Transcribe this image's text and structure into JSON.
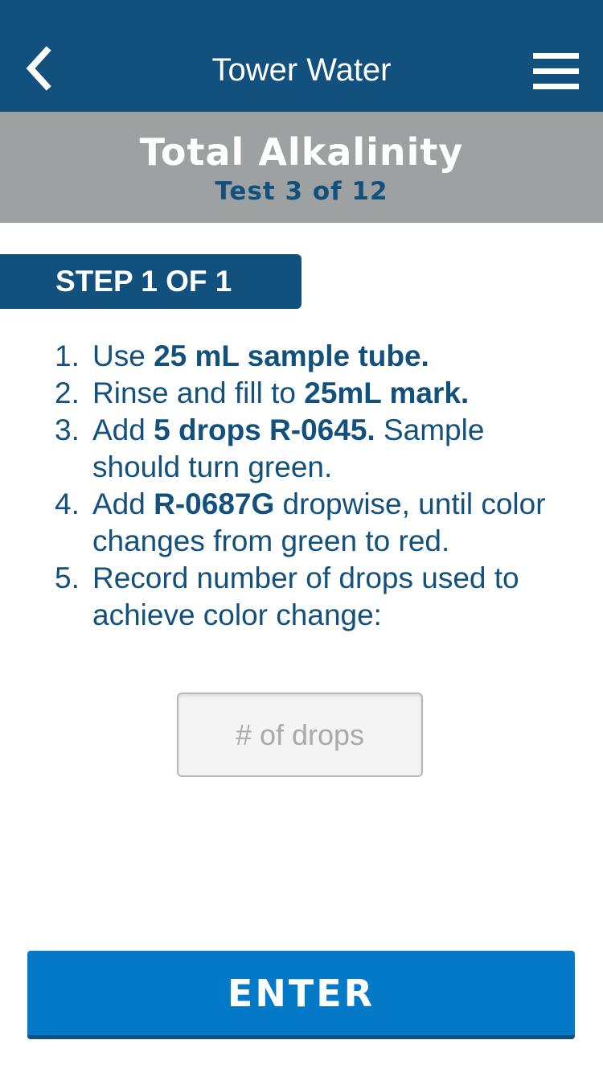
{
  "navbar": {
    "title": "Tower Water",
    "back_icon": "chevron-left-icon",
    "menu_icon": "hamburger-menu-icon",
    "background": "#12507d"
  },
  "test_header": {
    "title": "Total Alkalinity",
    "subtitle": "Test 3 of 12",
    "background": "#9ea1a2"
  },
  "step": {
    "label": "STEP 1 OF 1"
  },
  "instructions": [
    {
      "num": "1.",
      "parts": [
        {
          "text": "Use ",
          "bold": false
        },
        {
          "text": "25 mL sample tube.",
          "bold": true
        }
      ]
    },
    {
      "num": "2.",
      "parts": [
        {
          "text": "Rinse and fill to ",
          "bold": false
        },
        {
          "text": "25mL mark.",
          "bold": true
        }
      ]
    },
    {
      "num": "3.",
      "parts": [
        {
          "text": "Add ",
          "bold": false
        },
        {
          "text": "5 drops R-0645.",
          "bold": true
        },
        {
          "text": " Sample should turn green.",
          "bold": false
        }
      ]
    },
    {
      "num": "4.",
      "parts": [
        {
          "text": "Add ",
          "bold": false
        },
        {
          "text": "R-0687G",
          "bold": true
        },
        {
          "text": " dropwise, until color changes from green to red.",
          "bold": false
        }
      ]
    },
    {
      "num": "5.",
      "parts": [
        {
          "text": "Record number of drops used to achieve color change:",
          "bold": false
        }
      ]
    }
  ],
  "drops_input": {
    "placeholder": "# of drops",
    "value": ""
  },
  "enter_button": {
    "label": "ENTER",
    "color": "#0479c8"
  }
}
